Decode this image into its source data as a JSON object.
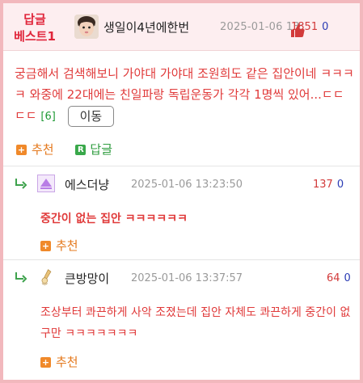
{
  "post": {
    "badge_line1": "답글",
    "badge_line2": "베스트1",
    "author": "생일이4년에한번",
    "timestamp": "2025-01-06 13:",
    "up": "1851",
    "down": "0",
    "body": "궁금해서 검색해보니 가야대 가야대 조원희도 같은 집안이네 ㅋㅋㅋㅋ 와중에 22대에는 친일파랑 독립운동가 각각 1명씩 있어...ㄷㄷㄷㄷ",
    "comment_count": "[6]",
    "move_button": "이동",
    "recommend_label": "추천",
    "reply_label": "답글",
    "reply_icon_letter": "R"
  },
  "replies": [
    {
      "author": "에스더냥",
      "timestamp": "2025-01-06 13:23:50",
      "up": "137",
      "down": "0",
      "text": "중간이 없는 집안 ㅋㅋㅋㅋㅋㅋ",
      "recommend_label": "추천"
    },
    {
      "author": "큰방망이",
      "timestamp": "2025-01-06 13:37:57",
      "up": "64",
      "down": "0",
      "text": "조상부터 콰끈하게 사악 조졌는데 집안 자체도 콰끈하게 중간이 없구만 ㅋㅋㅋㅋㅋㅋㅋ",
      "recommend_label": "추천"
    }
  ],
  "icons": {
    "reply_arrow": "reply-arrow-icon",
    "plus": "plus-icon"
  },
  "colors": {
    "accent_red": "#e03a3a",
    "border_pink": "#f2b8bd",
    "green": "#2f9c3f",
    "orange": "#e4781c",
    "blue": "#2a3bb4"
  }
}
